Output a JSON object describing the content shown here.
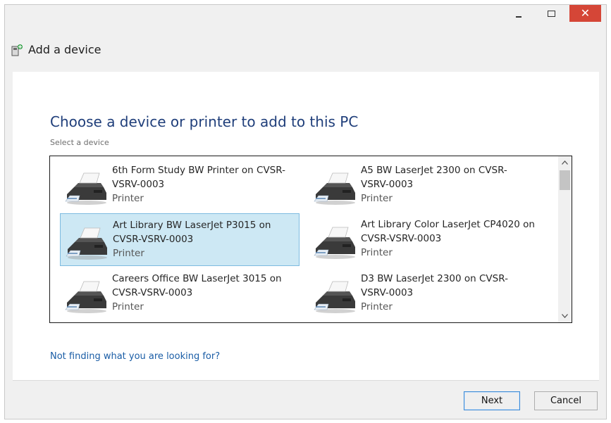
{
  "window": {
    "title": "Add a device",
    "controls": {
      "minimize": "minimize",
      "maximize": "maximize",
      "close": "✕"
    }
  },
  "main": {
    "heading": "Choose a device or printer to add to this PC",
    "subheading": "Select a device",
    "devices": [
      {
        "name_line1": "6th Form Study BW Printer on CVSR-",
        "name_line2": "VSRV-0003",
        "type": "Printer",
        "selected": false
      },
      {
        "name_line1": "A5 BW LaserJet 2300 on CVSR-",
        "name_line2": "VSRV-0003",
        "type": "Printer",
        "selected": false
      },
      {
        "name_line1": "Art Library BW LaserJet P3015 on",
        "name_line2": "CVSR-VSRV-0003",
        "type": "Printer",
        "selected": true
      },
      {
        "name_line1": "Art Library Color LaserJet CP4020 on",
        "name_line2": "CVSR-VSRV-0003",
        "type": "Printer",
        "selected": false
      },
      {
        "name_line1": "Careers Office BW LaserJet 3015 on",
        "name_line2": "CVSR-VSRV-0003",
        "type": "Printer",
        "selected": false
      },
      {
        "name_line1": "D3 BW LaserJet 2300 on CVSR-",
        "name_line2": "VSRV-0003",
        "type": "Printer",
        "selected": false
      }
    ],
    "help_link": "Not finding what you are looking for?"
  },
  "footer": {
    "next_label": "Next",
    "cancel_label": "Cancel"
  },
  "colors": {
    "heading": "#1f3e7a",
    "link": "#1a5da6",
    "selection_bg": "#cde8f4",
    "selection_border": "#7dbbe0",
    "close_button": "#d54637"
  },
  "icons": {
    "title": "add-device-icon",
    "device": "printer-icon",
    "scroll_up": "chevron-up-icon",
    "scroll_down": "chevron-down-icon"
  }
}
